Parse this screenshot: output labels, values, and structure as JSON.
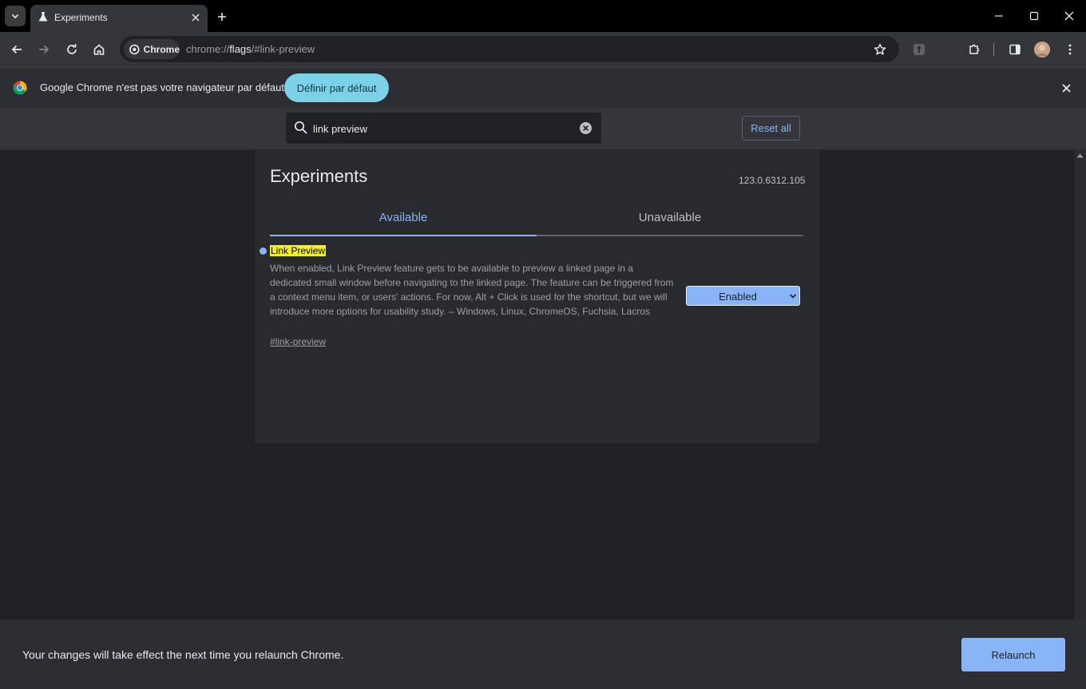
{
  "tab": {
    "title": "Experiments"
  },
  "toolbar": {
    "site_chip": "Chrome",
    "url_prefix": "chrome://",
    "url_host": "flags",
    "url_suffix": "/#link-preview"
  },
  "infobar": {
    "message": "Google Chrome n'est pas votre navigateur par défaut",
    "button_label": "Définir par défaut"
  },
  "search": {
    "value": "link preview"
  },
  "header": {
    "reset_label": "Reset all"
  },
  "main": {
    "title": "Experiments",
    "version": "123.0.6312.105",
    "tabs": [
      {
        "label": "Available",
        "active": true
      },
      {
        "label": "Unavailable",
        "active": false
      }
    ],
    "flag": {
      "name": "Link Preview",
      "description": "When enabled, Link Preview feature gets to be available to preview a linked page in a dedicated small window before navigating to the linked page. The feature can be triggered from a context menu item, or users' actions. For now, Alt + Click is used for the shortcut, but we will introduce more options for usability study. – Windows, Linux, ChromeOS, Fuchsia, Lacros",
      "link": "#link-preview",
      "selected_value": "Enabled"
    }
  },
  "footer": {
    "message": "Your changes will take effect the next time you relaunch Chrome.",
    "relaunch_label": "Relaunch"
  },
  "colors": {
    "accent": "#8ab4f8",
    "infobar_button": "#7cd1e6",
    "highlight": "#f5f119"
  }
}
